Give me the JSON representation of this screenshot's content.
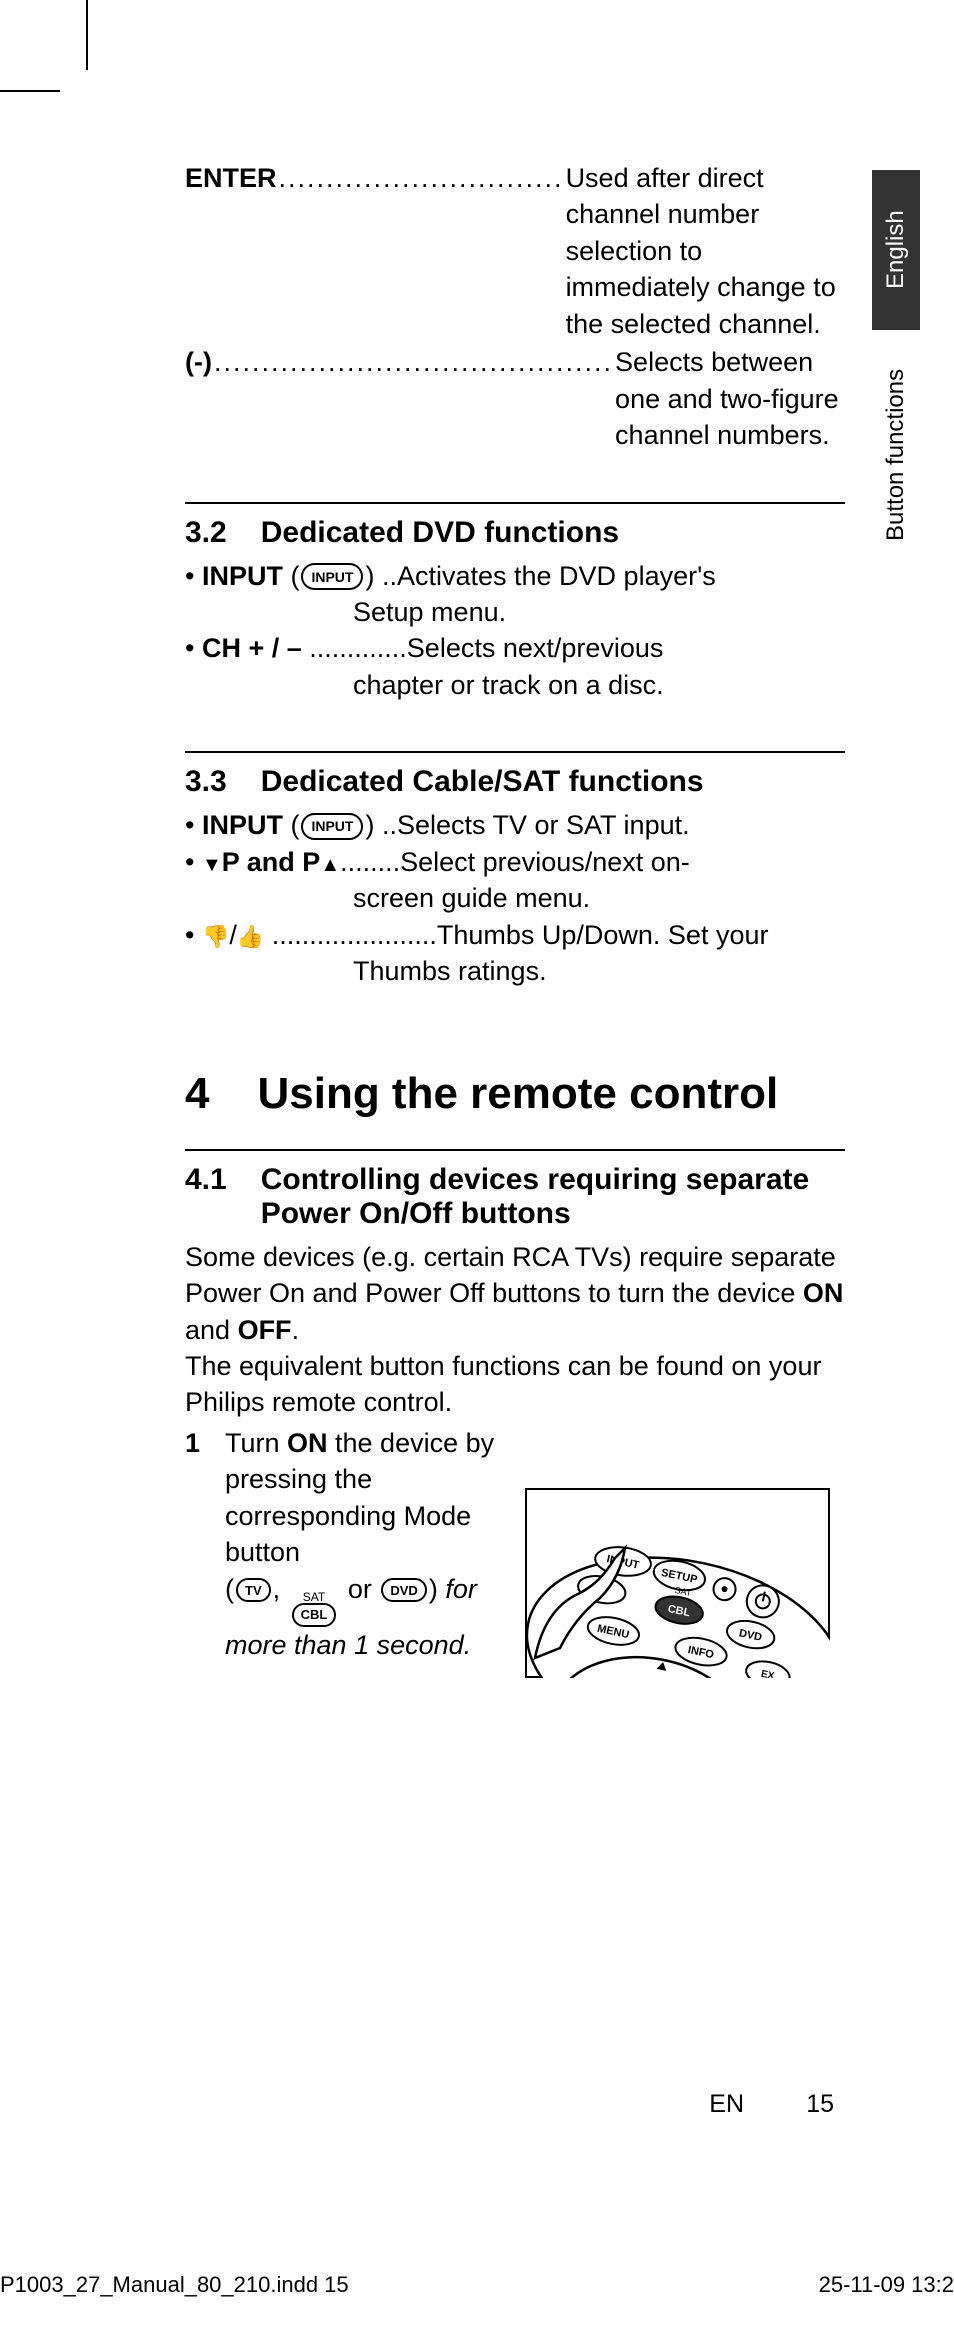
{
  "side_tabs": {
    "language": "English",
    "section": "Button functions"
  },
  "definitions": {
    "enter": {
      "term": "ENTER",
      "desc": "Used after direct channel number selection to immediately change to the selected channel."
    },
    "dash": {
      "term": "(-)",
      "desc": "Selects between one and two-figure channel numbers."
    }
  },
  "sec32": {
    "num": "3.2",
    "title": "Dedicated DVD functions",
    "items": {
      "input": {
        "term": "INPUT",
        "btn": "INPUT",
        "desc1": "Activates the DVD player's",
        "desc2": "Setup menu."
      },
      "ch": {
        "term": "CH + / –",
        "desc1": "Selects next/previous",
        "desc2": "chapter or track on a disc."
      }
    }
  },
  "sec33": {
    "num": "3.3",
    "title": "Dedicated Cable/SAT functions",
    "items": {
      "input": {
        "term": "INPUT",
        "btn": "INPUT",
        "desc": "Selects TV or SAT input."
      },
      "p": {
        "term": "P and P",
        "desc1": "Select previous/next on-",
        "desc2": "screen guide menu."
      },
      "thumbs": {
        "desc1": "Thumbs Up/Down. Set your",
        "desc2": "Thumbs ratings."
      }
    }
  },
  "sec4": {
    "num": "4",
    "title": "Using the remote control"
  },
  "sec41": {
    "num": "4.1",
    "title": "Controlling devices requiring separate Power On/Off buttons",
    "para1a": "Some devices (e.g. certain RCA TVs) require separate Power On and Power Off buttons to turn the device ",
    "bold_on": "ON",
    "and": " and ",
    "bold_off": "OFF",
    "para1b": ".",
    "para2": "The equivalent button functions can be found on your Philips remote control.",
    "step1": {
      "num": "1",
      "a": "Turn ",
      "on": "ON",
      "b": " the device by pressing the corresponding Mode button",
      "btn_tv": "TV",
      "btn_cbl_sat": "SAT",
      "btn_cbl": "CBL",
      "or": " or ",
      "btn_dvd": "DVD",
      "c": "for more than 1 second."
    }
  },
  "footer": {
    "lang_short": "EN",
    "page_num": "15",
    "file": "P1003_27_Manual_80_210.indd   15",
    "date": "25-11-09   13:2"
  }
}
